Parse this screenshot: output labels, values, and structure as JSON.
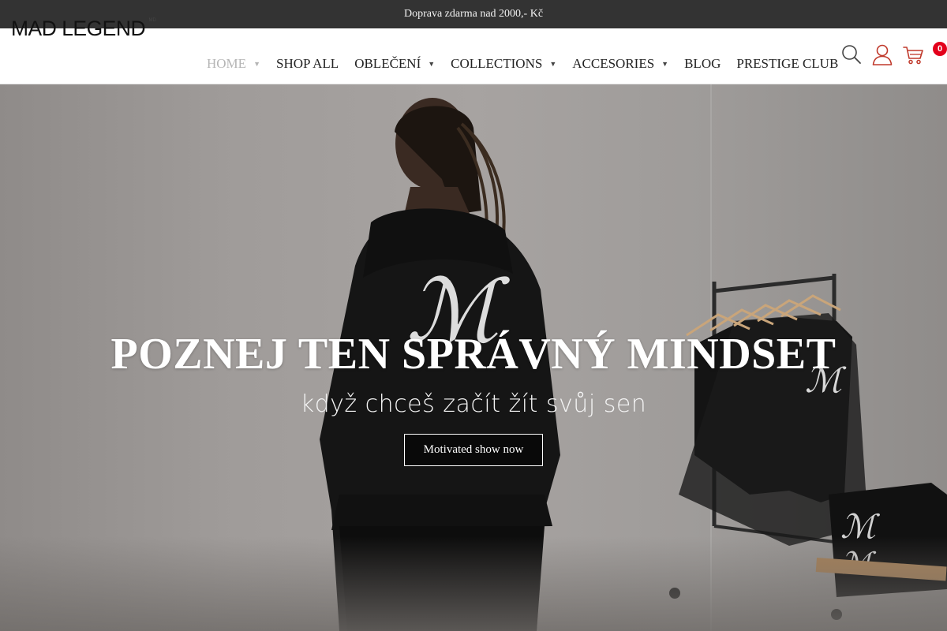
{
  "topbar": {
    "text": "Doprava zdarma nad 2000,- Kč"
  },
  "header": {
    "logo_text": "MAD LEGEND",
    "logo_sup": "MD",
    "cart_count": "0"
  },
  "nav": {
    "items": [
      {
        "label": "HOME",
        "has_dropdown": true,
        "active": true
      },
      {
        "label": "SHOP ALL",
        "has_dropdown": false
      },
      {
        "label": "OBLEČENÍ",
        "has_dropdown": true
      },
      {
        "label": "COLLECTIONS",
        "has_dropdown": true
      },
      {
        "label": "ACCESORIES",
        "has_dropdown": true
      },
      {
        "label": "BLOG",
        "has_dropdown": false
      },
      {
        "label": "PRESTIGE CLUB",
        "has_dropdown": false
      }
    ],
    "caret": "▼"
  },
  "icons": {
    "search": "search-icon",
    "account": "user-icon",
    "cart": "cart-icon"
  },
  "hero": {
    "title": "POZNEJ TEN SPRÁVNÝ MINDSET",
    "subtitle": "když chceš začít žít svůj sen",
    "button_label": "Motivated show now"
  },
  "colors": {
    "topbar_bg": "#333333",
    "accent_red": "#e3001b",
    "icon_red": "#c0392b",
    "nav_active": "#b5b5b5"
  }
}
